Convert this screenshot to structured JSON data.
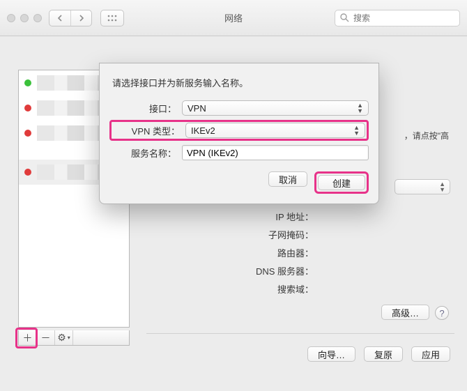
{
  "window": {
    "title": "网络",
    "search_placeholder": "搜索"
  },
  "sheet": {
    "prompt": "请选择接口并为新服务输入名称。",
    "interface_label": "接口：",
    "interface_value": "VPN",
    "vpntype_label": "VPN 类型：",
    "vpntype_value": "IKEv2",
    "servicename_label": "服务名称：",
    "servicename_value": "VPN (IKEv2)",
    "cancel": "取消",
    "create": "创建"
  },
  "detail": {
    "hint_fragment": "，请点按\"高",
    "rows": [
      "IP 地址：",
      "子网掩码：",
      "路由器：",
      "DNS 服务器：",
      "搜索域："
    ],
    "advanced": "高级…"
  },
  "footer": {
    "assist": "向导…",
    "revert": "复原",
    "apply": "应用"
  },
  "icons": {
    "gear": "⚙",
    "help": "?"
  }
}
